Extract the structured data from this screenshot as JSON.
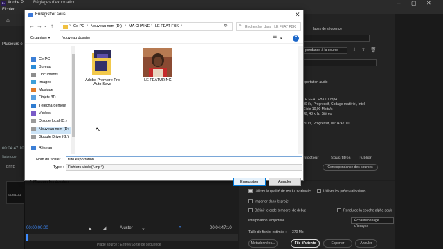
{
  "premiere": {
    "app_title": "Adobe P",
    "menu_first": "Fichier",
    "export_window_title": "Réglages d'exportation",
    "plus_label": "Plusieurs é",
    "time_left_panel": "00:04:47:10",
    "history_label": "Historique",
    "effects_label": "EFFE",
    "thumb_text": "SION LOG",
    "right_panel": {
      "sequence_label": "lages de séquence",
      "source_match_label": "pondance à la source",
      "export_audio_label": "xportation audio",
      "summary_line1": "LE FEAT FBK\\01.mp4",
      "summary_line2": "30 i/s, Progressif, Codage matériel, Intel",
      "summary_line3": "Cible 10,00 Mbits/s",
      "summary_line4": "48, 48 kHz, Stéréo",
      "summary_line5": "30 i/s, Progressif, 00:04:47:10",
      "tab_multiplayer": "ltilecteur",
      "tab_subtitles": "Sous-titres",
      "tab_publish": "Publier",
      "match_source_button": "Correspondance des sources"
    },
    "settings": {
      "use_max_quality": "Utiliser la qualité de rendu maximale",
      "use_previews": "Utiliser les prévisualisations",
      "import_project": "Importer dans le projet",
      "set_start_timecode": "Définir le code temporel de début",
      "render_alpha": "Rendu de la couche alpha seule",
      "time_interpolation_label": "Interpolation temporelle",
      "time_interpolation_value": "Échantillonnage d'images",
      "file_size_label": "Taille de fichier estimée :",
      "file_size_value": "370 Mo",
      "metadata_button": "Métadonnées...",
      "queue_button": "File d'attente",
      "export_button": "Exporter",
      "cancel_button": "Annuler"
    },
    "timebar": {
      "time_in": "00:00:00:00",
      "fit_label": "Ajuster",
      "time_out": "00:04:47:10"
    },
    "source_labels": "Plage source :    Entrée/Sortie de séquence",
    "scrub_progress": 0.0
  },
  "dialog": {
    "title": "Enregistrer sous",
    "breadcrumbs": [
      "Ce PC",
      "Nouveau nom (D:)",
      "MA CHAINE",
      "LE FEAT FBK"
    ],
    "search_placeholder": "Rechercher dans : LE FEAT FBK",
    "organize_label": "Organiser ▾",
    "new_folder_label": "Nouveau dossier",
    "nav_items": [
      {
        "label": "Ce PC",
        "icon": "computer-icon",
        "color": "#3c7fd6"
      },
      {
        "label": "Bureau",
        "icon": "desktop-icon",
        "color": "#2a8bd8"
      },
      {
        "label": "Documents",
        "icon": "documents-icon",
        "color": "#8d8d8d"
      },
      {
        "label": "Images",
        "icon": "pictures-icon",
        "color": "#3fa0d8"
      },
      {
        "label": "Musique",
        "icon": "music-icon",
        "color": "#e07a28"
      },
      {
        "label": "Objets 3D",
        "icon": "objects3d-icon",
        "color": "#5aa0e0"
      },
      {
        "label": "Téléchargement",
        "icon": "downloads-icon",
        "color": "#2e7bd0"
      },
      {
        "label": "Vidéos",
        "icon": "videos-icon",
        "color": "#7a5bc8"
      },
      {
        "label": "Disque local (C:)",
        "icon": "drive-icon",
        "color": "#9a9a9a"
      },
      {
        "label": "Nouveau nom (D:",
        "icon": "drive-icon",
        "color": "#9a9a9a"
      },
      {
        "label": "Google Drive (G:)",
        "icon": "drive-icon",
        "color": "#9a9a9a"
      },
      {
        "label": "Réseau",
        "icon": "network-icon",
        "color": "#3c7fd6"
      }
    ],
    "selected_nav": "Nouveau nom (D:",
    "files": [
      {
        "label": "Adobe Premiere Pro Auto-Save",
        "kind": "folder"
      },
      {
        "label": "LE FEATURING",
        "kind": "image"
      }
    ],
    "filename_label": "Nom du fichier :",
    "filename_value": "tuto exportation",
    "type_label": "Type :",
    "type_value": "Fichiers vidéo(*.mp4)",
    "hide_folders_label": "Masquer les dossiers",
    "save_button": "Enregistrer",
    "cancel_button": "Annuler"
  },
  "colors": {
    "accent_blue": "#3e8cff",
    "dialog_primary": "#0078d7"
  }
}
